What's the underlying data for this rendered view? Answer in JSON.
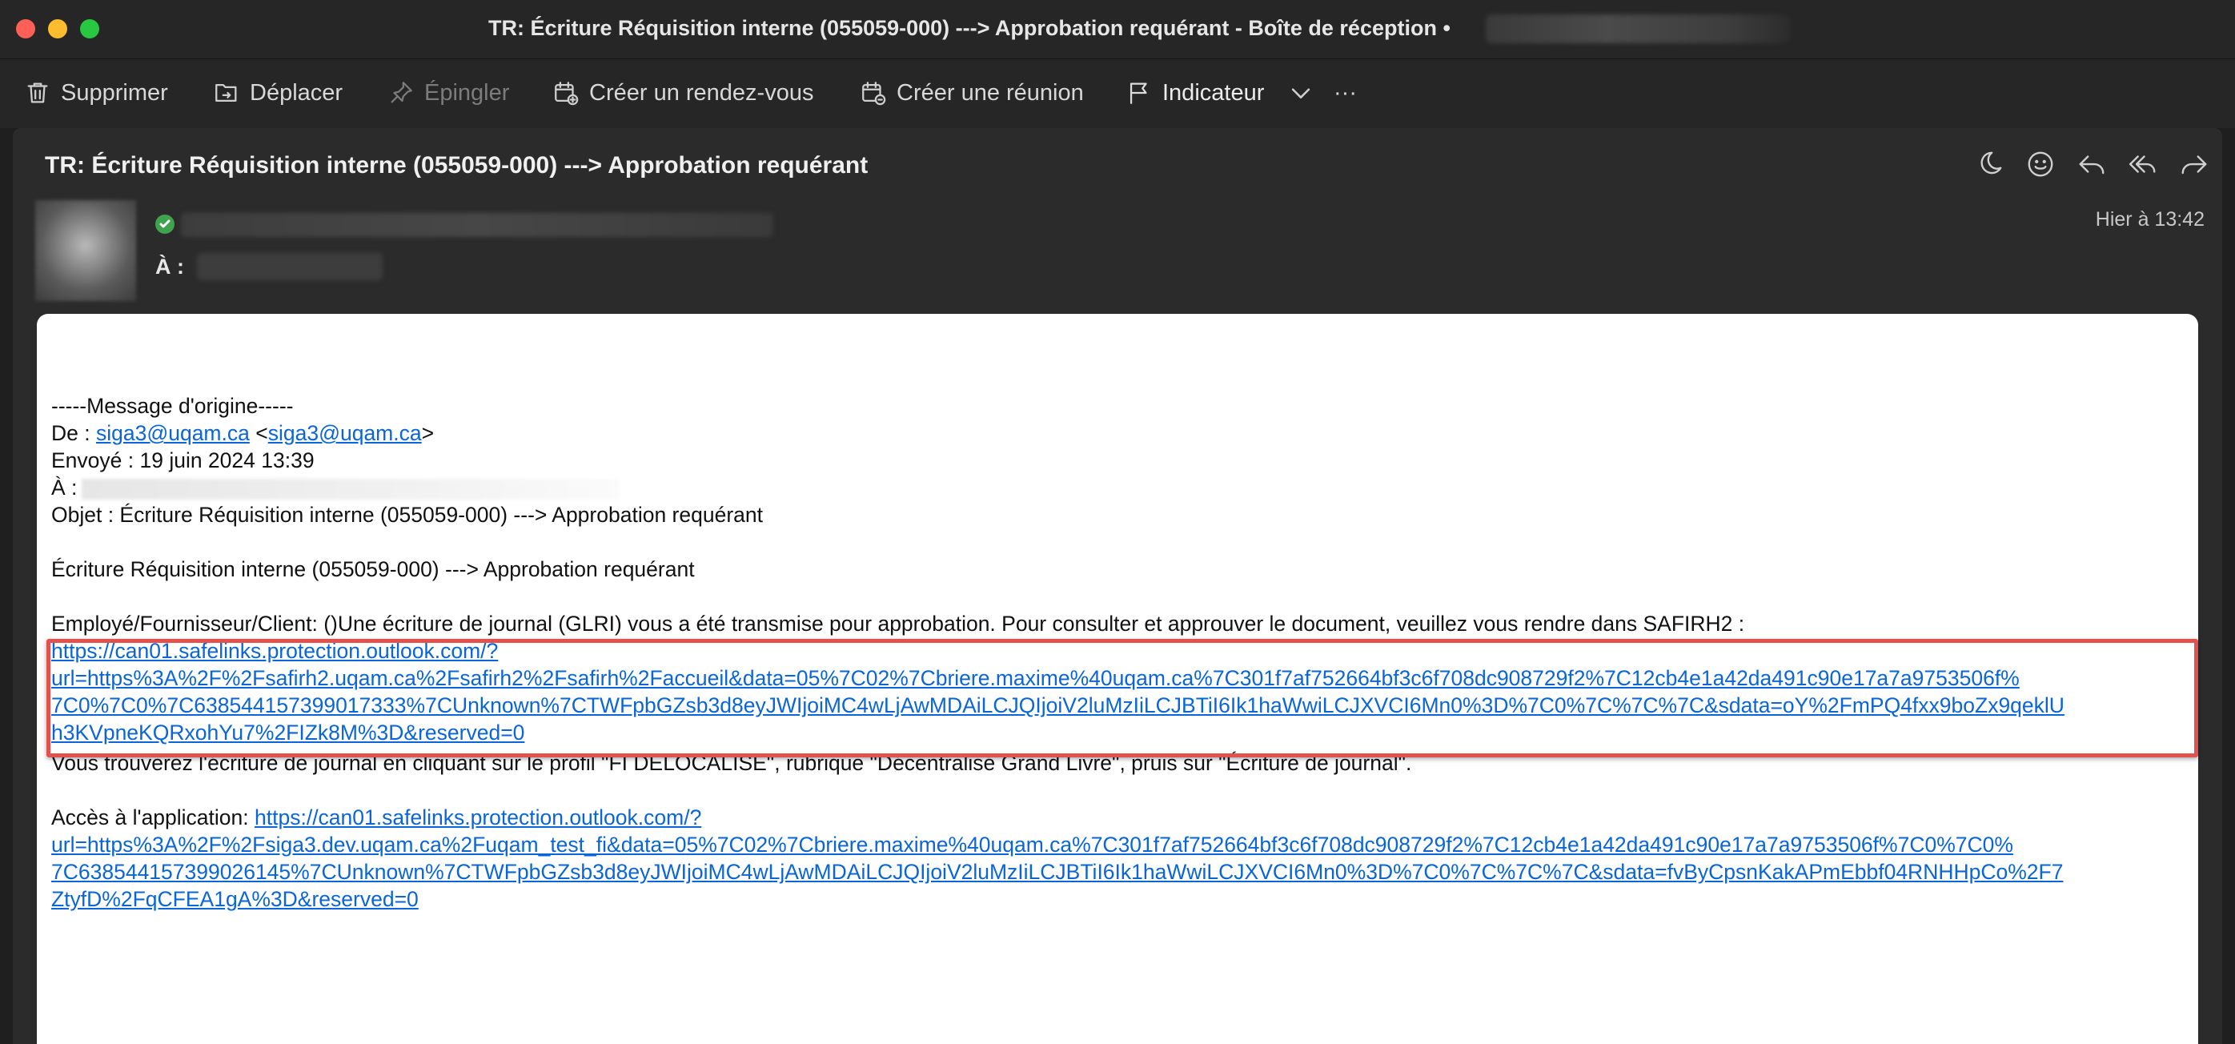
{
  "window": {
    "title": "TR: Écriture Réquisition interne (055059-000) ---> Approbation requérant - Boîte de réception •"
  },
  "toolbar": {
    "delete_label": "Supprimer",
    "move_label": "Déplacer",
    "pin_label": "Épingler",
    "appointment_label": "Créer un rendez-vous",
    "meeting_label": "Créer une réunion",
    "flag_label": "Indicateur",
    "more_label": "···"
  },
  "message": {
    "subject": "TR: Écriture Réquisition interne (055059-000) ---> Approbation requérant",
    "to_label": "À :",
    "timestamp": "Hier à 13:42"
  },
  "body": {
    "orig_header": "-----Message d'origine-----",
    "from_prefix": "De : ",
    "from_email": "siga3@uqam.ca",
    "from_lt": " <",
    "from_email2": "siga3@uqam.ca",
    "from_gt": ">",
    "sent": "Envoyé : 19 juin 2024 13:39",
    "to_prefix": "À :",
    "subject_line": "Objet : Écriture Réquisition interne (055059-000) ---> Approbation requérant",
    "heading": "Écriture Réquisition interne (055059-000) ---> Approbation requérant",
    "intro": "Employé/Fournisseur/Client:  ()Une écriture de journal (GLRI) vous a été transmise pour approbation. Pour consulter et approuver le document, veuillez vous rendre dans SAFIRH2 :",
    "link1_lines": [
      "https://can01.safelinks.protection.outlook.com/?",
      "url=https%3A%2F%2Fsafirh2.uqam.ca%2Fsafirh2%2Fsafirh%2Faccueil&data=05%7C02%7Cbriere.maxime%40uqam.ca%7C301f7af752664bf3c6f708dc908729f2%7C12cb4e1a42da491c90e17a7a9753506f%",
      "7C0%7C0%7C638544157399017333%7CUnknown%7CTWFpbGZsb3d8eyJWIjoiMC4wLjAwMDAiLCJQIjoiV2luMzIiLCJBTiI6Ik1haWwiLCJXVCI6Mn0%3D%7C0%7C%7C%7C&sdata=oY%2FmPQ4fxx9boZx9qeklU",
      "h3KVpneKQRxohYu7%2FIZk8M%3D&reserved=0"
    ],
    "instructions": "Vous trouverez l'écriture de journal en cliquant sur le profil \"FI DELOCALISE\", rubrique \"Décentralisé Grand Livre\", pruis sur \"Écriture de journal\".",
    "access_prefix": "Accès à l'application: ",
    "link2_lines": [
      "https://can01.safelinks.protection.outlook.com/?",
      "url=https%3A%2F%2Fsiga3.dev.uqam.ca%2Fuqam_test_fi&data=05%7C02%7Cbriere.maxime%40uqam.ca%7C301f7af752664bf3c6f708dc908729f2%7C12cb4e1a42da491c90e17a7a9753506f%7C0%7C0%",
      "7C638544157399026145%7CUnknown%7CTWFpbGZsb3d8eyJWIjoiMC4wLjAwMDAiLCJQIjoiV2luMzIiLCJBTiI6Ik1haWwiLCJXVCI6Mn0%3D%7C0%7C%7C%7C&sdata=fvByCpsnKakAPmEbbf04RNHHpCo%2F7",
      "ZtyfD%2FqCFEA1gA%3D&reserved=0"
    ]
  },
  "colors": {
    "link": "#0a66d8",
    "highlight": "#e0524b",
    "verified": "#3fa34d"
  },
  "icons": [
    "trash-icon",
    "folder-move-icon",
    "pin-icon",
    "calendar-add-icon",
    "meeting-add-icon",
    "flag-icon",
    "chevron-down-icon",
    "more-icon",
    "moon-icon",
    "emoji-icon",
    "reply-icon",
    "reply-all-icon",
    "forward-icon",
    "verified-check-icon"
  ]
}
